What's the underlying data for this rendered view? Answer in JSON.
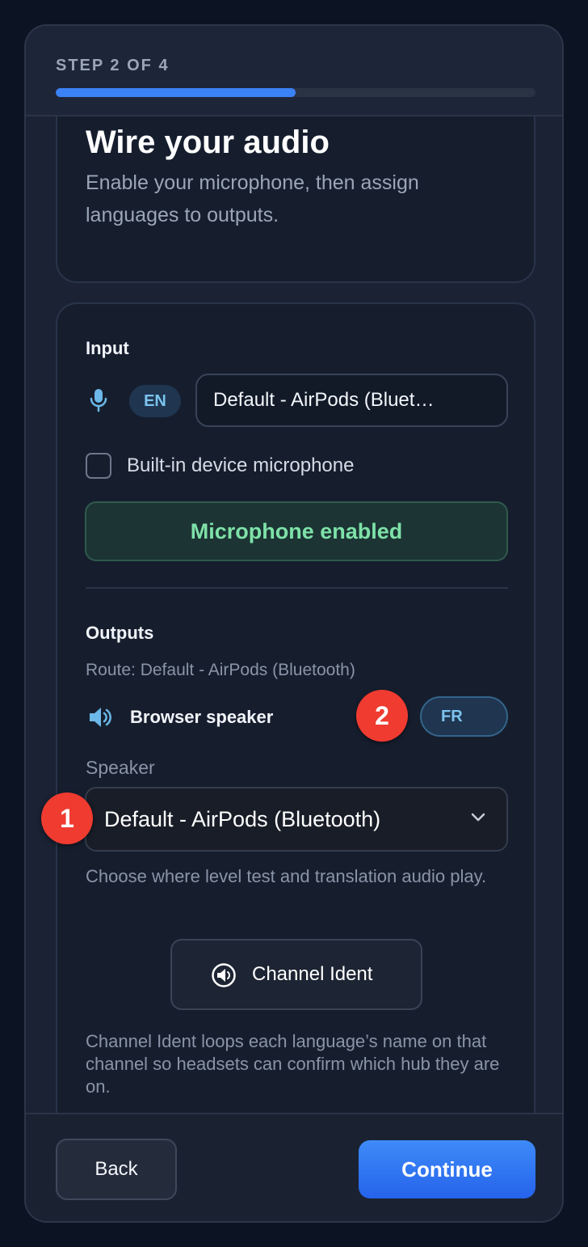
{
  "header": {
    "step_label": "STEP 2 OF 4",
    "progress_fraction": 0.5
  },
  "intro": {
    "title": "Wire your audio",
    "subtitle": "Enable your microphone, then assign languages to outputs."
  },
  "input_section": {
    "title": "Input",
    "icon": "microphone-icon",
    "language": "EN",
    "device": "Default - AirPods (Bluet…",
    "builtin_checkbox_label": "Built-in device microphone",
    "builtin_checked": false,
    "mic_status": "Microphone enabled"
  },
  "outputs_section": {
    "title": "Outputs",
    "route": "Route: Default - AirPods (Bluetooth)",
    "speaker_icon": "speaker-icon",
    "speaker_name": "Browser speaker",
    "language": "FR",
    "speaker_label": "Speaker",
    "speaker_selected": "Default - AirPods (Bluetooth)",
    "help": "Choose where level test and translation audio play.",
    "ident_button": "Channel Ident",
    "ident_note": "Channel Ident loops each language’s name on that channel so headsets can confirm which hub they are on."
  },
  "footer": {
    "back": "Back",
    "continue": "Continue"
  },
  "markers": [
    "1",
    "2"
  ],
  "colors": {
    "accent": "#3b82f6",
    "success": "#7ee2a8",
    "pill_text": "#7cc4ee",
    "marker": "#ef3b30"
  }
}
